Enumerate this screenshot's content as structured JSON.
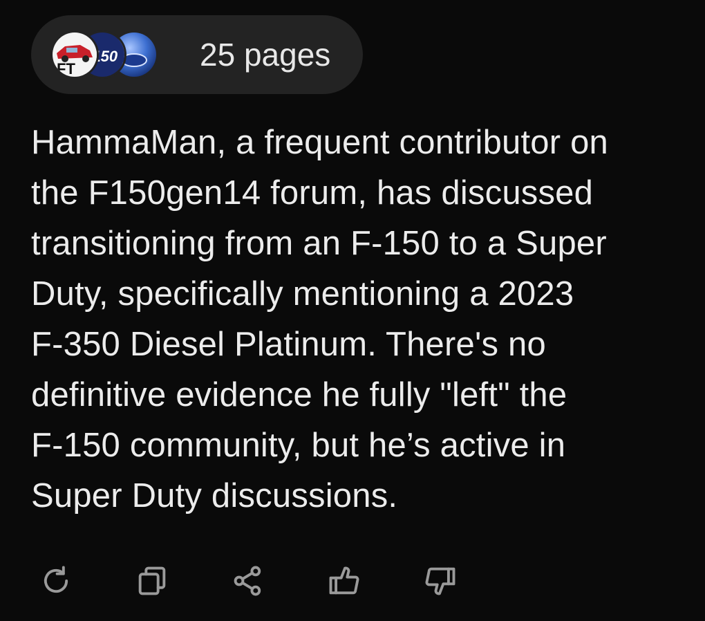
{
  "sources": {
    "favicons": [
      {
        "icon": "forum-car-logo-icon",
        "label": "FT"
      },
      {
        "icon": "f150-logo-icon",
        "label": "F150"
      },
      {
        "icon": "ford-oval-logo-icon",
        "label": ""
      }
    ],
    "pages_label": "25 pages"
  },
  "answer": {
    "lines": [
      "HammaMan, a frequent contributor on",
      "the F150gen14 forum, has discussed",
      "transitioning from an F-150 to a Super",
      "Duty, specifically mentioning a 2023",
      "F-350 Diesel Platinum. There's no",
      "definitive evidence he fully \"left\" the",
      "F-150 community, but he’s active in",
      "Super Duty discussions."
    ]
  },
  "actions": [
    {
      "icon": "regenerate-icon"
    },
    {
      "icon": "copy-icon"
    },
    {
      "icon": "share-icon"
    },
    {
      "icon": "thumbs-up-icon"
    },
    {
      "icon": "thumbs-down-icon"
    }
  ],
  "colors": {
    "background": "#0a0a0a",
    "pill": "#232323",
    "text": "#ececec",
    "icon": "#9a9a9a"
  }
}
